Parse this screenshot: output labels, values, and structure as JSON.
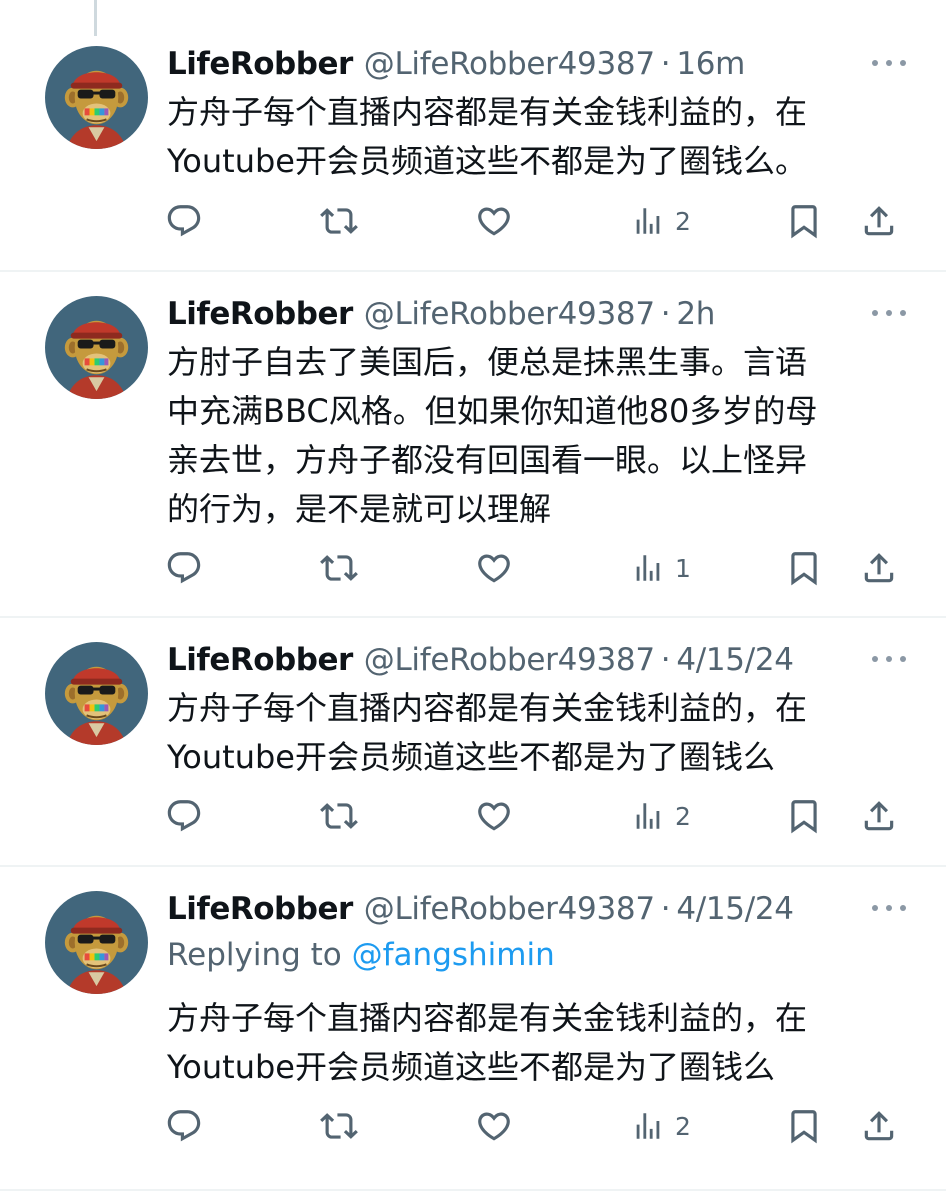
{
  "tweets": [
    {
      "display_name": "LifeRobber",
      "handle": "@LifeRobber49387",
      "separator": "·",
      "time": "16m",
      "text": "方舟子每个直播内容都是有关金钱利益的，在\nYoutube开会员频道这些不都是为了圈钱么。",
      "replies": "",
      "retweets": "",
      "likes": "",
      "views": "2"
    },
    {
      "display_name": "LifeRobber",
      "handle": "@LifeRobber49387",
      "separator": "·",
      "time": "2h",
      "text": "方肘子自去了美国后，便总是抹黑生事。言语\n中充满BBC风格。但如果你知道他80多岁的母\n亲去世，方舟子都没有回国看一眼。以上怪异\n的行为，是不是就可以理解",
      "replies": "",
      "retweets": "",
      "likes": "",
      "views": "1"
    },
    {
      "display_name": "LifeRobber",
      "handle": "@LifeRobber49387",
      "separator": "·",
      "time": "4/15/24",
      "text": "方舟子每个直播内容都是有关金钱利益的，在\nYoutube开会员频道这些不都是为了圈钱么",
      "replies": "",
      "retweets": "",
      "likes": "",
      "views": "2"
    },
    {
      "display_name": "LifeRobber",
      "handle": "@LifeRobber49387",
      "separator": "·",
      "time": "4/15/24",
      "replying_prefix": "Replying to",
      "replying_to": "@fangshimin",
      "text": "方舟子每个直播内容都是有关金钱利益的，在\nYoutube开会员频道这些不都是为了圈钱么",
      "replies": "",
      "retweets": "",
      "likes": "",
      "views": "2"
    }
  ],
  "icons": {
    "more": "more-horizontal-icon",
    "reply": "reply-icon",
    "retweet": "retweet-icon",
    "like": "heart-icon",
    "views": "views-chart-icon",
    "bookmark": "bookmark-icon",
    "share": "share-icon"
  },
  "colors": {
    "text_primary": "#0f1419",
    "text_secondary": "#536471",
    "link": "#1d9bf0",
    "divider": "#eff3f4",
    "avatar_bg": "#41667c"
  }
}
